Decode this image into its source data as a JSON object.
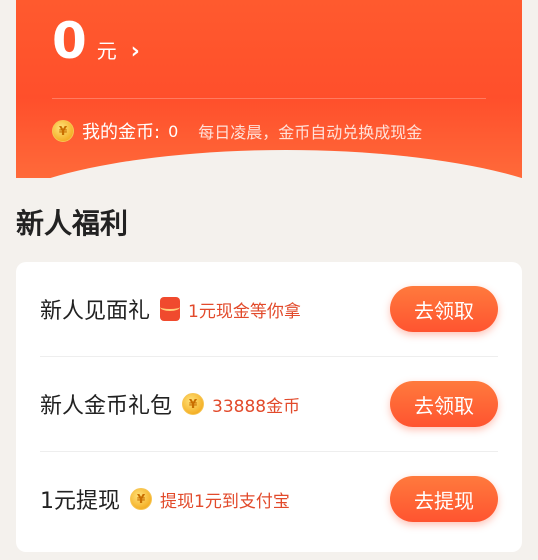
{
  "balance": {
    "amount": "0",
    "unit": "元",
    "arrow": "›"
  },
  "coins": {
    "icon": "¥",
    "label": "我的金币:",
    "value": "0",
    "note": "每日凌晨，金币自动兑换成现金"
  },
  "section": {
    "title": "新人福利"
  },
  "rows": [
    {
      "title": "新人见面礼",
      "icon": "red-envelope-icon",
      "desc": "1元现金等你拿",
      "button": "去领取"
    },
    {
      "title": "新人金币礼包",
      "icon": "coin-icon",
      "desc": "33888金币",
      "button": "去领取"
    },
    {
      "title": "1元提现",
      "icon": "coin-icon",
      "desc": "提现1元到支付宝",
      "button": "去提现"
    }
  ],
  "colors": {
    "accent": "#ff5430",
    "desc": "#e24a2b",
    "background": "#f4f1ed"
  }
}
